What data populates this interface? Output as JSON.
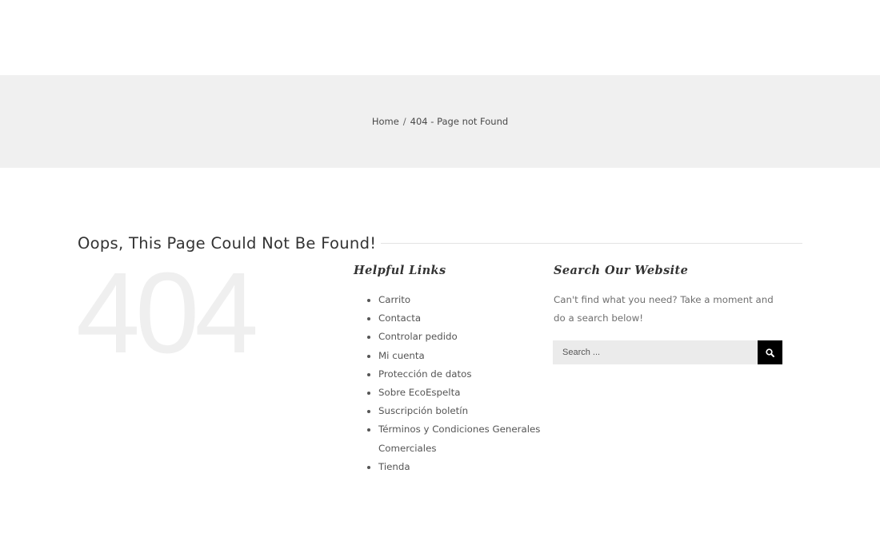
{
  "breadcrumb": {
    "home": "Home",
    "separator": "/",
    "current": "404 - Page not Found"
  },
  "page": {
    "heading": "Oops, This Page Could Not Be Found!",
    "big_number": "404"
  },
  "helpful_links": {
    "title": "Helpful Links",
    "items": [
      "Carrito",
      "Contacta",
      "Controlar pedido",
      "Mi cuenta",
      "Protección de datos",
      "Sobre EcoEspelta",
      "Suscripción boletín",
      "Términos y Condiciones Generales Comerciales",
      "Tienda"
    ]
  },
  "search": {
    "title": "Search Our Website",
    "description": "Can't find what you need? Take a moment and do a search below!",
    "placeholder": "Search ...",
    "button_icon": "search-icon"
  },
  "colors": {
    "title_bar_bg": "#f0f0f0",
    "big_404": "#efefef",
    "search_input_bg": "#ebebeb",
    "search_button_bg": "#000000"
  }
}
